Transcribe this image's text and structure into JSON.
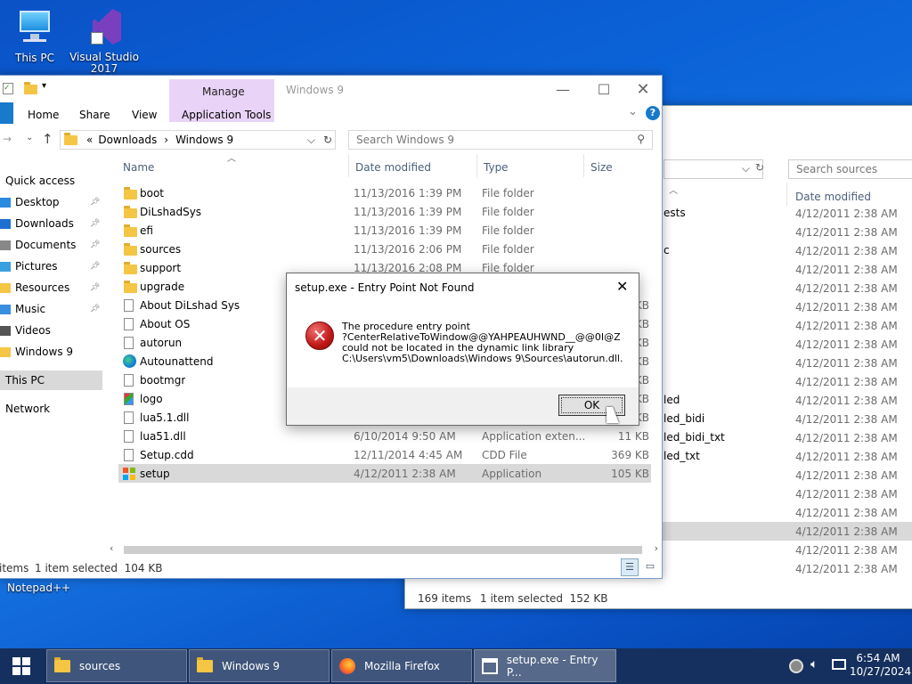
{
  "desktop": {
    "icons": [
      {
        "label": "This PC"
      },
      {
        "label": "Visual Studio 2017"
      }
    ],
    "notepad_label": "Notepad++"
  },
  "back_window": {
    "search_placeholder": "Search sources",
    "column_date": "Date modified",
    "partial_names": [
      "ests",
      "c",
      "led",
      "led_bidi",
      "led_bidi_txt",
      "led_txt"
    ],
    "dates": [
      "4/12/2011 2:38 AM",
      "4/12/2011 2:38 AM",
      "4/12/2011 2:38 AM",
      "4/12/2011 2:38 AM",
      "4/12/2011 2:38 AM",
      "4/12/2011 2:38 AM",
      "4/12/2011 2:38 AM",
      "4/12/2011 2:38 AM",
      "4/12/2011 2:38 AM",
      "4/12/2011 2:38 AM",
      "4/12/2011 2:38 AM",
      "4/12/2011 2:38 AM",
      "4/12/2011 2:38 AM",
      "4/12/2011 2:38 AM",
      "4/12/2011 2:38 AM",
      "4/12/2011 2:38 AM",
      "4/12/2011 2:38 AM",
      "4/12/2011 2:38 AM",
      "4/12/2011 2:38 AM",
      "4/12/2011 2:38 AM"
    ],
    "status_items": "169 items",
    "status_selected": "1 item selected  152 KB"
  },
  "explorer": {
    "title": "Windows 9",
    "manage_label": "Manage",
    "ribbon_tabs": [
      "Home",
      "Share",
      "View",
      "Application Tools"
    ],
    "breadcrumb": [
      "Downloads",
      "Windows 9"
    ],
    "breadcrumb_sep": "«",
    "search_placeholder": "Search Windows 9",
    "columns": {
      "name": "Name",
      "date": "Date modified",
      "type": "Type",
      "size": "Size"
    },
    "nav": {
      "quick_access": "Quick access",
      "items": [
        "Desktop",
        "Downloads",
        "Documents",
        "Pictures",
        "Resources",
        "Music",
        "Videos",
        "Windows 9"
      ],
      "this_pc": "This PC",
      "network": "Network"
    },
    "files": [
      {
        "name": "boot",
        "date": "11/13/2016 1:39 PM",
        "type": "File folder",
        "size": "",
        "icon": "folder-icon"
      },
      {
        "name": "DiLshadSys",
        "date": "11/13/2016 1:39 PM",
        "type": "File folder",
        "size": "",
        "icon": "folder-icon"
      },
      {
        "name": "efi",
        "date": "11/13/2016 1:39 PM",
        "type": "File folder",
        "size": "",
        "icon": "folder-icon"
      },
      {
        "name": "sources",
        "date": "11/13/2016 2:06 PM",
        "type": "File folder",
        "size": "",
        "icon": "folder-icon"
      },
      {
        "name": "support",
        "date": "11/13/2016 2:08 PM",
        "type": "File folder",
        "size": "",
        "icon": "folder-icon"
      },
      {
        "name": "upgrade",
        "date": "",
        "type": "",
        "size": "",
        "icon": "folder-icon"
      },
      {
        "name": "About DiLshad Sys",
        "date": "",
        "type": "",
        "size": "KB",
        "icon": "document-icon"
      },
      {
        "name": "About OS",
        "date": "",
        "type": "",
        "size": "KB",
        "icon": "document-icon"
      },
      {
        "name": "autorun",
        "date": "",
        "type": "",
        "size": "KB",
        "icon": "settings-file-icon"
      },
      {
        "name": "Autounattend",
        "date": "",
        "type": "",
        "size": "KB",
        "icon": "edge-icon"
      },
      {
        "name": "bootmgr",
        "date": "",
        "type": "",
        "size": "KB",
        "icon": "document-icon"
      },
      {
        "name": "logo",
        "date": "",
        "type": "",
        "size": "KB",
        "icon": "image-icon"
      },
      {
        "name": "lua5.1.dll",
        "date": "",
        "type": "",
        "size": "KB",
        "icon": "dll-icon"
      },
      {
        "name": "lua51.dll",
        "date": "6/10/2014 9:50 AM",
        "type": "Application exten...",
        "size": "11 KB",
        "icon": "dll-icon"
      },
      {
        "name": "Setup.cdd",
        "date": "12/11/2014 4:45 AM",
        "type": "CDD File",
        "size": "369 KB",
        "icon": "document-icon"
      },
      {
        "name": "setup",
        "date": "4/12/2011 2:38 AM",
        "type": "Application",
        "size": "105 KB",
        "icon": "windows-app-icon"
      }
    ],
    "status_items": "items",
    "status_selected": "1 item selected  104 KB"
  },
  "dialog": {
    "title": "setup.exe - Entry Point Not Found",
    "message": [
      "The procedure entry point",
      "?CenterRelativeToWindow@@YAHPEAUHWND__@@0I@Z",
      "could not be located in the dynamic link library",
      "C:\\Users\\vm5\\Downloads\\Windows 9\\Sources\\autorun.dll."
    ],
    "ok_label": "OK"
  },
  "taskbar": {
    "buttons": [
      {
        "label": "sources",
        "icon": "folder-icon"
      },
      {
        "label": "Windows 9",
        "icon": "folder-icon"
      },
      {
        "label": "Mozilla Firefox",
        "icon": "firefox-icon"
      },
      {
        "label": "setup.exe - Entry P...",
        "icon": "dialog-icon"
      }
    ],
    "time": "6:54 AM",
    "date": "10/27/2024"
  }
}
